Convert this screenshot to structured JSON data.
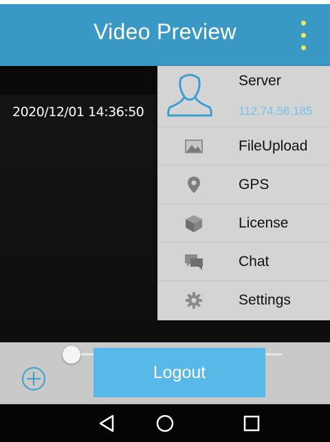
{
  "header": {
    "title": "Video Preview",
    "menu_icon": "overflow-menu-icon",
    "background_color": "#3a99c4",
    "menu_icon_color": "#f0e95d"
  },
  "video": {
    "timestamp": "2020/12/01 14:36:50"
  },
  "menu": {
    "server": {
      "label": "Server",
      "ip": "112.74.56.185",
      "icon": "user-outline-icon",
      "ip_color": "#6ec4ee"
    },
    "items": [
      {
        "label": "FileUpload",
        "icon": "image-icon"
      },
      {
        "label": "GPS",
        "icon": "location-pin-icon"
      },
      {
        "label": "License",
        "icon": "cube-icon"
      },
      {
        "label": "Chat",
        "icon": "chat-bubble-icon"
      },
      {
        "label": "Settings",
        "icon": "gear-icon"
      }
    ]
  },
  "controls": {
    "logout_label": "Logout",
    "zoom_icon": "zoom-in-icon",
    "slider_value": 0.0,
    "accent_color": "#58b8e8"
  },
  "navbar": {
    "back_icon": "back-triangle-icon",
    "home_icon": "home-circle-icon",
    "recents_icon": "recents-square-icon"
  }
}
